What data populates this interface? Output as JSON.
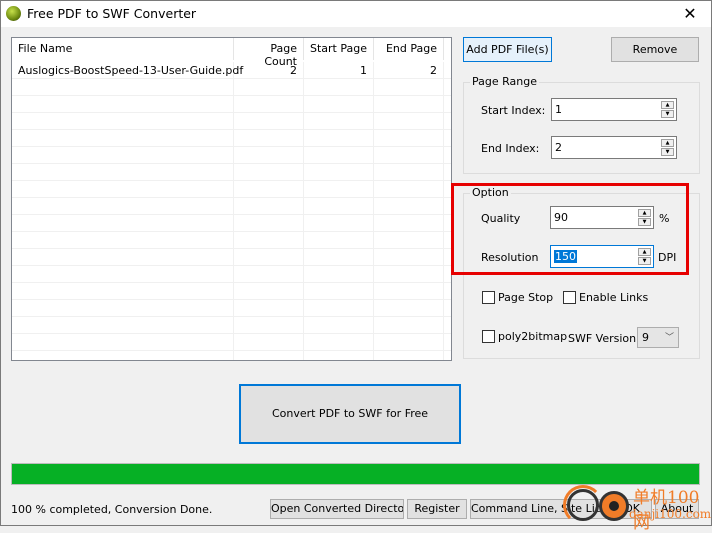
{
  "window": {
    "title": "Free PDF to SWF Converter"
  },
  "file_list": {
    "columns": [
      "File Name",
      "Page Count",
      "Start Page",
      "End Page"
    ],
    "rows": [
      {
        "file_name": "Auslogics-BoostSpeed-13-User-Guide.pdf",
        "page_count": "2",
        "start_page": "1",
        "end_page": "2"
      }
    ]
  },
  "buttons": {
    "add": "Add PDF File(s)",
    "remove": "Remove",
    "convert": "Convert PDF to SWF for Free",
    "open_dir": "Open Converted Directory",
    "register": "Register",
    "command_line": "Command Line, Site Licence",
    "ok": "OK",
    "about": "About"
  },
  "page_range": {
    "label": "Page Range",
    "start_label": "Start Index:",
    "start_value": "1",
    "end_label": "End Index:",
    "end_value": "2"
  },
  "option": {
    "label": "Option",
    "quality_label": "Quality",
    "quality_value": "90",
    "quality_unit": "%",
    "resolution_label": "Resolution",
    "resolution_value": "150",
    "resolution_unit": "DPI",
    "page_stop": "Page Stop",
    "enable_links": "Enable Links",
    "poly2bitmap": "poly2bitmap",
    "swf_version_label": "SWF Version",
    "swf_version_value": "9"
  },
  "progress": {
    "percent": 100,
    "color": "#06b025"
  },
  "status": "100 % completed, Conversion Done.",
  "watermark": {
    "line1": "单机100网",
    "line2": "danji100.com"
  }
}
